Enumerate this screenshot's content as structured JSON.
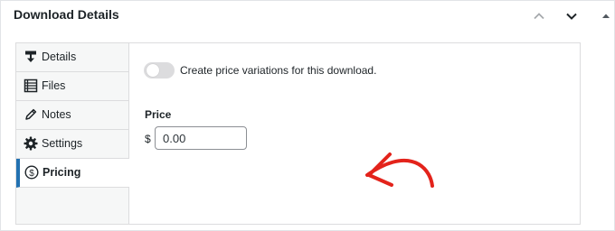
{
  "metabox": {
    "title": "Download Details",
    "controls": [
      "chevron-up-icon",
      "chevron-down-icon",
      "triangle-up-icon"
    ]
  },
  "tabs": [
    {
      "label": "Details",
      "icon": "download-icon",
      "active": false
    },
    {
      "label": "Files",
      "icon": "list-icon",
      "active": false
    },
    {
      "label": "Notes",
      "icon": "pencil-icon",
      "active": false
    },
    {
      "label": "Settings",
      "icon": "gear-icon",
      "active": false
    },
    {
      "label": "Pricing",
      "icon": "dollar-circle-icon",
      "active": true
    }
  ],
  "pricing": {
    "variations_toggle": {
      "label": "Create price variations for this download.",
      "enabled": false
    },
    "price_label": "Price",
    "currency_symbol": "$",
    "price_value": "0.00"
  },
  "colors": {
    "accent": "#2271b1",
    "annotation_arrow": "#e3231b"
  }
}
